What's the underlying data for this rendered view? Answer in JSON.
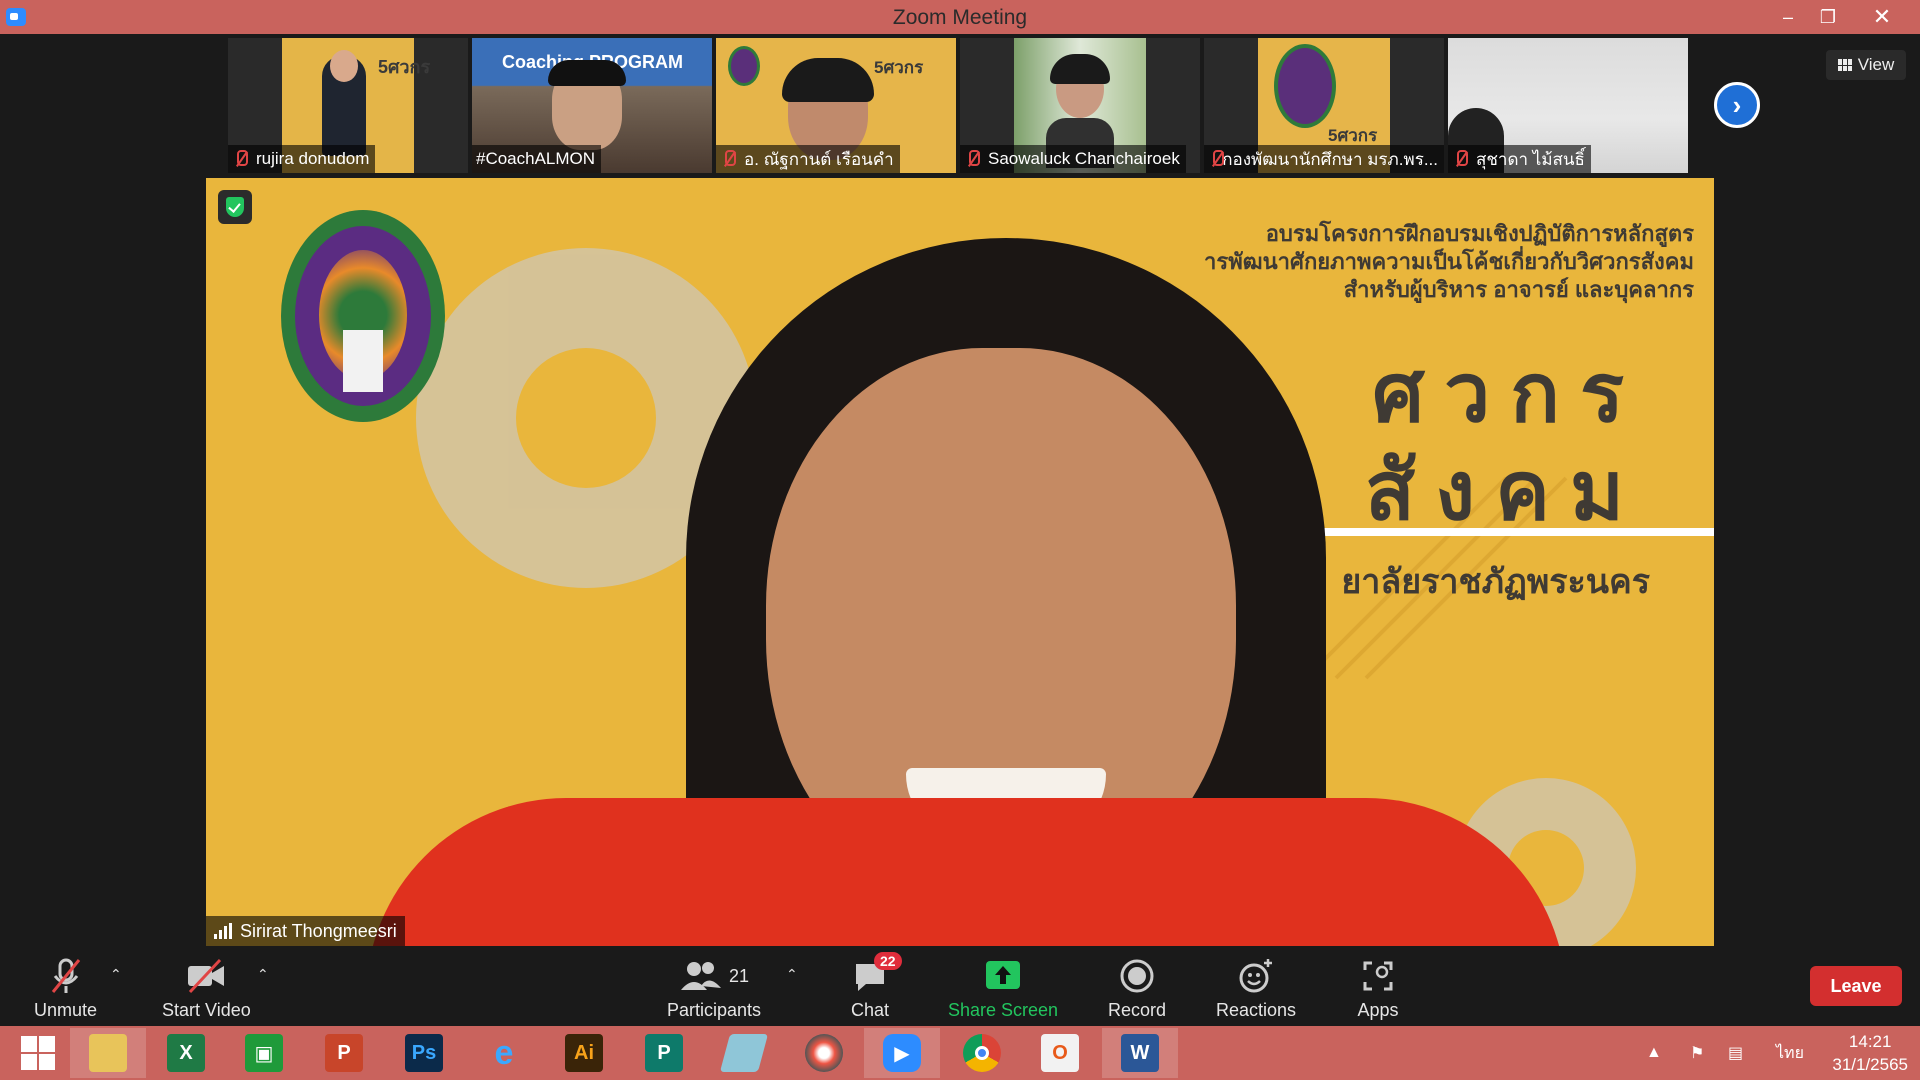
{
  "window": {
    "title": "Zoom Meeting"
  },
  "participants_strip": [
    {
      "name": "rujira donudom"
    },
    {
      "name": "#CoachALMON"
    },
    {
      "name": "อ. ณัฐกานต์ เรือนคำ"
    },
    {
      "name": "Saowaluck Chanchairoek"
    },
    {
      "name": "กองพัฒนานักศึกษา มรภ.พร..."
    },
    {
      "name": "สุชาดา ไม้สนธิ์"
    }
  ],
  "thumb_texts": {
    "coaching_program": "Coaching PROGRAM"
  },
  "view_button": {
    "label": "View"
  },
  "main_video": {
    "speaker_name": "Sirirat Thongmeesri",
    "headline_line1": "อบรมโครงการฝึกอบรมเชิงปฏิบัติการหลักสูตร",
    "headline_line2": "ารพัฒนาศักยภาพความเป็นโค้ชเกี่ยวกับวิศวกรสังคม",
    "headline_line3": "สำหรับผู้บริหาร อาจารย์ และบุคลากร",
    "big_text_1": "ศวกร",
    "big_text_2": "สังคม",
    "university_text": "ยาลัยราชภัฏพระนคร"
  },
  "toolbar": {
    "unmute": "Unmute",
    "start_video": "Start Video",
    "participants": "Participants",
    "participants_count": "21",
    "chat": "Chat",
    "chat_badge": "22",
    "share_screen": "Share Screen",
    "record": "Record",
    "reactions": "Reactions",
    "apps": "Apps",
    "leave": "Leave"
  },
  "taskbar": {
    "apps": [
      {
        "name": "windows-start",
        "glyph": ""
      },
      {
        "name": "file-explorer",
        "glyph": ""
      },
      {
        "name": "excel",
        "glyph": "X"
      },
      {
        "name": "store",
        "glyph": ""
      },
      {
        "name": "powerpoint",
        "glyph": "P"
      },
      {
        "name": "photoshop",
        "glyph": "Ps"
      },
      {
        "name": "internet-explorer",
        "glyph": "e"
      },
      {
        "name": "illustrator",
        "glyph": "Ai"
      },
      {
        "name": "publisher",
        "glyph": "P"
      },
      {
        "name": "eraser-app",
        "glyph": ""
      },
      {
        "name": "photoscape",
        "glyph": ""
      },
      {
        "name": "zoom",
        "glyph": ""
      },
      {
        "name": "chrome",
        "glyph": ""
      },
      {
        "name": "office",
        "glyph": ""
      },
      {
        "name": "word",
        "glyph": "W"
      }
    ],
    "language": "ไทย",
    "time": "14:21",
    "date": "31/1/2565"
  },
  "colors": {
    "titlebar": "#c9635d",
    "slide_yellow": "#e9b63c",
    "share_green": "#22c55e",
    "leave_red": "#d32f2f",
    "arrow_blue": "#1f6fd6"
  }
}
